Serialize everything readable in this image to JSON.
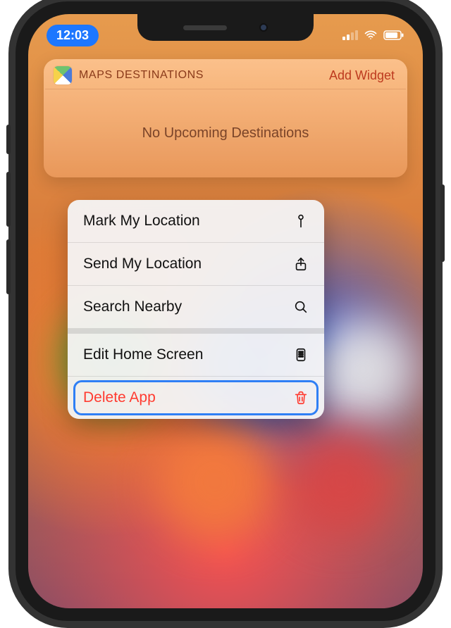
{
  "status": {
    "time": "12:03"
  },
  "widget": {
    "title": "MAPS DESTINATIONS",
    "action": "Add Widget",
    "body": "No Upcoming Destinations"
  },
  "menu": {
    "items": [
      {
        "label": "Mark My Location"
      },
      {
        "label": "Send My Location"
      },
      {
        "label": "Search Nearby"
      },
      {
        "label": "Edit Home Screen"
      },
      {
        "label": "Delete App"
      }
    ]
  }
}
